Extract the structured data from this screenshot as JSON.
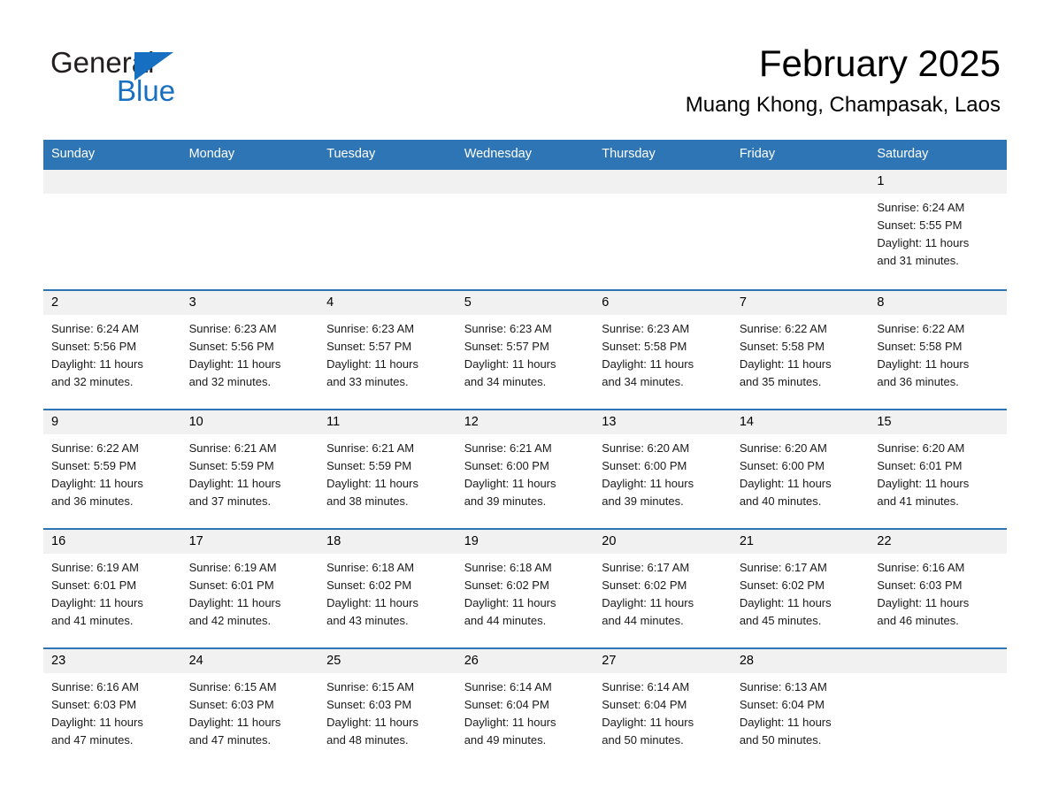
{
  "brand": {
    "name_part1": "General",
    "name_part2": "Blue",
    "accent_color": "#176fc1",
    "triangle_icon": "triangle-icon"
  },
  "header": {
    "month_title": "February 2025",
    "location": "Muang Khong, Champasak, Laos"
  },
  "theme": {
    "header_blue": "#2e75b6",
    "row_divider_blue": "#2e75b6",
    "daynum_band_gray": "#f1f1f1"
  },
  "calendar": {
    "weekdays": [
      "Sunday",
      "Monday",
      "Tuesday",
      "Wednesday",
      "Thursday",
      "Friday",
      "Saturday"
    ],
    "weeks": [
      [
        {
          "day": "",
          "sunrise": "",
          "sunset": "",
          "daylight_line1": "",
          "daylight_line2": ""
        },
        {
          "day": "",
          "sunrise": "",
          "sunset": "",
          "daylight_line1": "",
          "daylight_line2": ""
        },
        {
          "day": "",
          "sunrise": "",
          "sunset": "",
          "daylight_line1": "",
          "daylight_line2": ""
        },
        {
          "day": "",
          "sunrise": "",
          "sunset": "",
          "daylight_line1": "",
          "daylight_line2": ""
        },
        {
          "day": "",
          "sunrise": "",
          "sunset": "",
          "daylight_line1": "",
          "daylight_line2": ""
        },
        {
          "day": "",
          "sunrise": "",
          "sunset": "",
          "daylight_line1": "",
          "daylight_line2": ""
        },
        {
          "day": "1",
          "sunrise": "Sunrise: 6:24 AM",
          "sunset": "Sunset: 5:55 PM",
          "daylight_line1": "Daylight: 11 hours",
          "daylight_line2": "and 31 minutes."
        }
      ],
      [
        {
          "day": "2",
          "sunrise": "Sunrise: 6:24 AM",
          "sunset": "Sunset: 5:56 PM",
          "daylight_line1": "Daylight: 11 hours",
          "daylight_line2": "and 32 minutes."
        },
        {
          "day": "3",
          "sunrise": "Sunrise: 6:23 AM",
          "sunset": "Sunset: 5:56 PM",
          "daylight_line1": "Daylight: 11 hours",
          "daylight_line2": "and 32 minutes."
        },
        {
          "day": "4",
          "sunrise": "Sunrise: 6:23 AM",
          "sunset": "Sunset: 5:57 PM",
          "daylight_line1": "Daylight: 11 hours",
          "daylight_line2": "and 33 minutes."
        },
        {
          "day": "5",
          "sunrise": "Sunrise: 6:23 AM",
          "sunset": "Sunset: 5:57 PM",
          "daylight_line1": "Daylight: 11 hours",
          "daylight_line2": "and 34 minutes."
        },
        {
          "day": "6",
          "sunrise": "Sunrise: 6:23 AM",
          "sunset": "Sunset: 5:58 PM",
          "daylight_line1": "Daylight: 11 hours",
          "daylight_line2": "and 34 minutes."
        },
        {
          "day": "7",
          "sunrise": "Sunrise: 6:22 AM",
          "sunset": "Sunset: 5:58 PM",
          "daylight_line1": "Daylight: 11 hours",
          "daylight_line2": "and 35 minutes."
        },
        {
          "day": "8",
          "sunrise": "Sunrise: 6:22 AM",
          "sunset": "Sunset: 5:58 PM",
          "daylight_line1": "Daylight: 11 hours",
          "daylight_line2": "and 36 minutes."
        }
      ],
      [
        {
          "day": "9",
          "sunrise": "Sunrise: 6:22 AM",
          "sunset": "Sunset: 5:59 PM",
          "daylight_line1": "Daylight: 11 hours",
          "daylight_line2": "and 36 minutes."
        },
        {
          "day": "10",
          "sunrise": "Sunrise: 6:21 AM",
          "sunset": "Sunset: 5:59 PM",
          "daylight_line1": "Daylight: 11 hours",
          "daylight_line2": "and 37 minutes."
        },
        {
          "day": "11",
          "sunrise": "Sunrise: 6:21 AM",
          "sunset": "Sunset: 5:59 PM",
          "daylight_line1": "Daylight: 11 hours",
          "daylight_line2": "and 38 minutes."
        },
        {
          "day": "12",
          "sunrise": "Sunrise: 6:21 AM",
          "sunset": "Sunset: 6:00 PM",
          "daylight_line1": "Daylight: 11 hours",
          "daylight_line2": "and 39 minutes."
        },
        {
          "day": "13",
          "sunrise": "Sunrise: 6:20 AM",
          "sunset": "Sunset: 6:00 PM",
          "daylight_line1": "Daylight: 11 hours",
          "daylight_line2": "and 39 minutes."
        },
        {
          "day": "14",
          "sunrise": "Sunrise: 6:20 AM",
          "sunset": "Sunset: 6:00 PM",
          "daylight_line1": "Daylight: 11 hours",
          "daylight_line2": "and 40 minutes."
        },
        {
          "day": "15",
          "sunrise": "Sunrise: 6:20 AM",
          "sunset": "Sunset: 6:01 PM",
          "daylight_line1": "Daylight: 11 hours",
          "daylight_line2": "and 41 minutes."
        }
      ],
      [
        {
          "day": "16",
          "sunrise": "Sunrise: 6:19 AM",
          "sunset": "Sunset: 6:01 PM",
          "daylight_line1": "Daylight: 11 hours",
          "daylight_line2": "and 41 minutes."
        },
        {
          "day": "17",
          "sunrise": "Sunrise: 6:19 AM",
          "sunset": "Sunset: 6:01 PM",
          "daylight_line1": "Daylight: 11 hours",
          "daylight_line2": "and 42 minutes."
        },
        {
          "day": "18",
          "sunrise": "Sunrise: 6:18 AM",
          "sunset": "Sunset: 6:02 PM",
          "daylight_line1": "Daylight: 11 hours",
          "daylight_line2": "and 43 minutes."
        },
        {
          "day": "19",
          "sunrise": "Sunrise: 6:18 AM",
          "sunset": "Sunset: 6:02 PM",
          "daylight_line1": "Daylight: 11 hours",
          "daylight_line2": "and 44 minutes."
        },
        {
          "day": "20",
          "sunrise": "Sunrise: 6:17 AM",
          "sunset": "Sunset: 6:02 PM",
          "daylight_line1": "Daylight: 11 hours",
          "daylight_line2": "and 44 minutes."
        },
        {
          "day": "21",
          "sunrise": "Sunrise: 6:17 AM",
          "sunset": "Sunset: 6:02 PM",
          "daylight_line1": "Daylight: 11 hours",
          "daylight_line2": "and 45 minutes."
        },
        {
          "day": "22",
          "sunrise": "Sunrise: 6:16 AM",
          "sunset": "Sunset: 6:03 PM",
          "daylight_line1": "Daylight: 11 hours",
          "daylight_line2": "and 46 minutes."
        }
      ],
      [
        {
          "day": "23",
          "sunrise": "Sunrise: 6:16 AM",
          "sunset": "Sunset: 6:03 PM",
          "daylight_line1": "Daylight: 11 hours",
          "daylight_line2": "and 47 minutes."
        },
        {
          "day": "24",
          "sunrise": "Sunrise: 6:15 AM",
          "sunset": "Sunset: 6:03 PM",
          "daylight_line1": "Daylight: 11 hours",
          "daylight_line2": "and 47 minutes."
        },
        {
          "day": "25",
          "sunrise": "Sunrise: 6:15 AM",
          "sunset": "Sunset: 6:03 PM",
          "daylight_line1": "Daylight: 11 hours",
          "daylight_line2": "and 48 minutes."
        },
        {
          "day": "26",
          "sunrise": "Sunrise: 6:14 AM",
          "sunset": "Sunset: 6:04 PM",
          "daylight_line1": "Daylight: 11 hours",
          "daylight_line2": "and 49 minutes."
        },
        {
          "day": "27",
          "sunrise": "Sunrise: 6:14 AM",
          "sunset": "Sunset: 6:04 PM",
          "daylight_line1": "Daylight: 11 hours",
          "daylight_line2": "and 50 minutes."
        },
        {
          "day": "28",
          "sunrise": "Sunrise: 6:13 AM",
          "sunset": "Sunset: 6:04 PM",
          "daylight_line1": "Daylight: 11 hours",
          "daylight_line2": "and 50 minutes."
        },
        {
          "day": "",
          "sunrise": "",
          "sunset": "",
          "daylight_line1": "",
          "daylight_line2": ""
        }
      ]
    ]
  }
}
